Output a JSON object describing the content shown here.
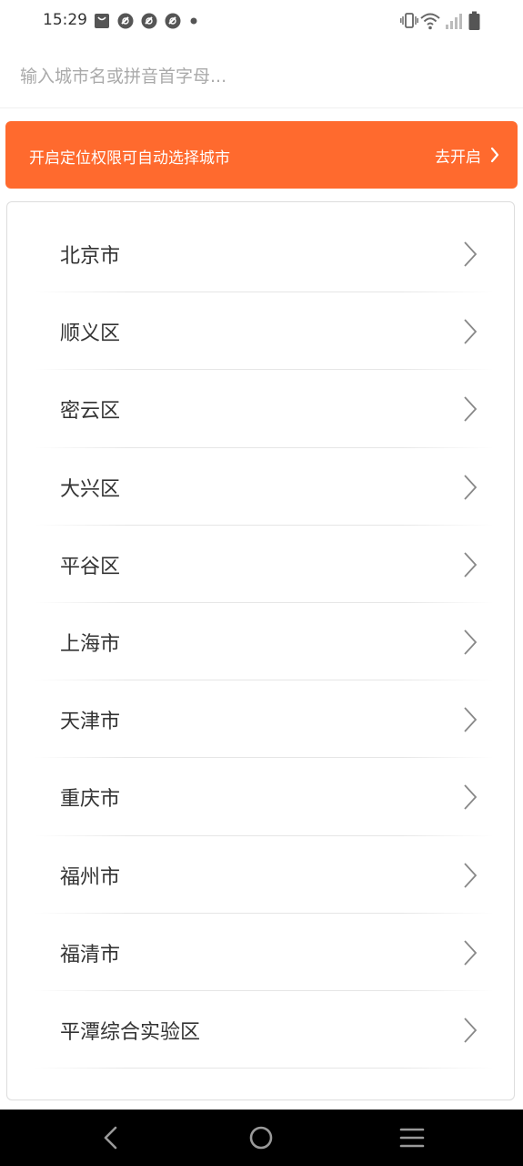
{
  "status_bar": {
    "time": "15:29",
    "icons_left": [
      "shopping-bag-icon",
      "app-notification-icon",
      "app-notification-icon",
      "app-notification-icon",
      "more-notifications-dot-icon"
    ],
    "icons_right": [
      "vibrate-icon",
      "wifi-icon",
      "cell-signal-icon",
      "battery-icon"
    ]
  },
  "search": {
    "placeholder": "输入城市名或拼音首字母..."
  },
  "location_banner": {
    "message": "开启定位权限可自动选择城市",
    "action_label": "去开启",
    "background_color": "#ff6a2e"
  },
  "cities": [
    {
      "name": "北京市"
    },
    {
      "name": "顺义区"
    },
    {
      "name": "密云区"
    },
    {
      "name": "大兴区"
    },
    {
      "name": "平谷区"
    },
    {
      "name": "上海市"
    },
    {
      "name": "天津市"
    },
    {
      "name": "重庆市"
    },
    {
      "name": "福州市"
    },
    {
      "name": "福清市"
    },
    {
      "name": "平潭综合实验区"
    }
  ],
  "nav_bar": {
    "buttons": [
      "back-icon",
      "home-icon",
      "menu-icon"
    ]
  }
}
